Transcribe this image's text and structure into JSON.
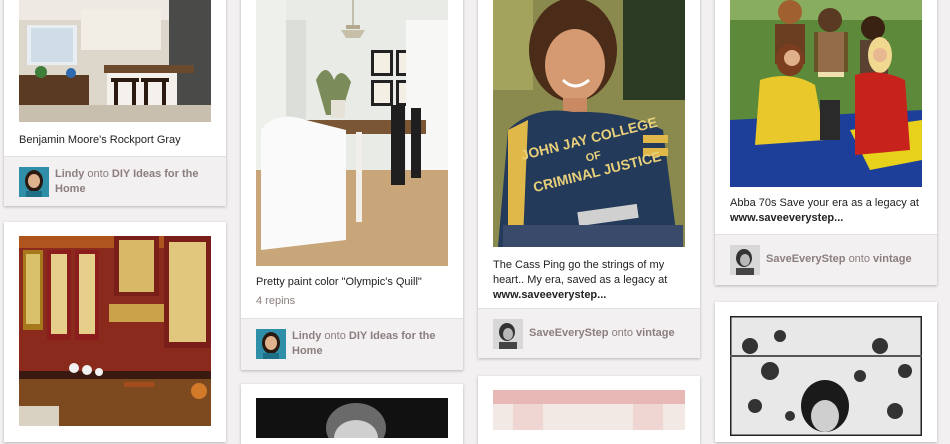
{
  "pins": [
    {
      "caption": "Benjamin Moore's Rockport Gray",
      "user": "Lindy",
      "onto": "onto",
      "board": "DIY Ideas for the Home",
      "image_desc": "kitchen-photo"
    },
    {
      "caption": "Pretty paint color \"Olympic's Quill\"",
      "repins": "4 repins",
      "user": "Lindy",
      "onto": "onto",
      "board": "DIY Ideas for the Home",
      "image_desc": "dining-room-photo"
    },
    {
      "caption": "The Cass Ping go the strings of my heart.. My era, saved as a legacy at",
      "caption_link": "www.saveeverystep...",
      "user": "SaveEveryStep",
      "onto": "onto",
      "board": "vintage",
      "image_desc": "man-in-tshirt-photo",
      "shirt_text": [
        "JOHN JAY COLLEGE",
        "OF",
        "CRIMINAL JUSTICE"
      ]
    },
    {
      "caption": "Abba 70s Save your era as a legacy at",
      "caption_link": "www.saveeverystep...",
      "user": "SaveEveryStep",
      "onto": "onto",
      "board": "vintage",
      "image_desc": "band-group-photo"
    }
  ],
  "colors": {
    "background": "#f2f0f0",
    "card": "#ffffff",
    "attribution_bg": "#f2f0f0",
    "muted_text": "#8c7e7e"
  }
}
